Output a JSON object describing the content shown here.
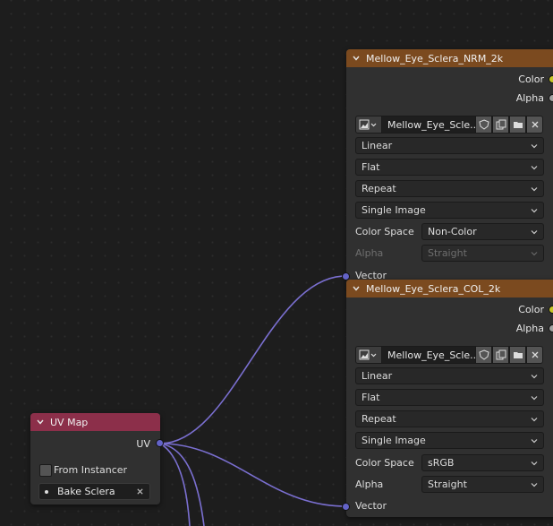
{
  "colors": {
    "texture_header": "#7b4a1f",
    "uvmap_header": "#8c2f4a",
    "node_body": "#303030",
    "link": "#7a6fd0",
    "color_socket": "#c7c729",
    "alpha_socket": "#a1a1a1",
    "vector_socket": "#6363c7"
  },
  "nodes": {
    "nrm": {
      "title": "Mellow_Eye_Sclera_NRM_2k",
      "outputs": {
        "color": "Color",
        "alpha": "Alpha"
      },
      "image_name": "Mellow_Eye_Scle...",
      "interpolation": "Linear",
      "projection": "Flat",
      "extension": "Repeat",
      "source": "Single Image",
      "color_space_label": "Color Space",
      "color_space": "Non-Color",
      "alpha_label": "Alpha",
      "alpha_mode": "Straight",
      "input_vector": "Vector"
    },
    "col": {
      "title": "Mellow_Eye_Sclera_COL_2k",
      "outputs": {
        "color": "Color",
        "alpha": "Alpha"
      },
      "image_name": "Mellow_Eye_Scle...",
      "interpolation": "Linear",
      "projection": "Flat",
      "extension": "Repeat",
      "source": "Single Image",
      "color_space_label": "Color Space",
      "color_space": "sRGB",
      "alpha_label": "Alpha",
      "alpha_mode": "Straight",
      "input_vector": "Vector"
    },
    "uvmap": {
      "title": "UV Map",
      "output_uv": "UV",
      "from_instancer_label": "From Instancer",
      "from_instancer_checked": false,
      "uv_layer": "Bake Sclera"
    }
  }
}
